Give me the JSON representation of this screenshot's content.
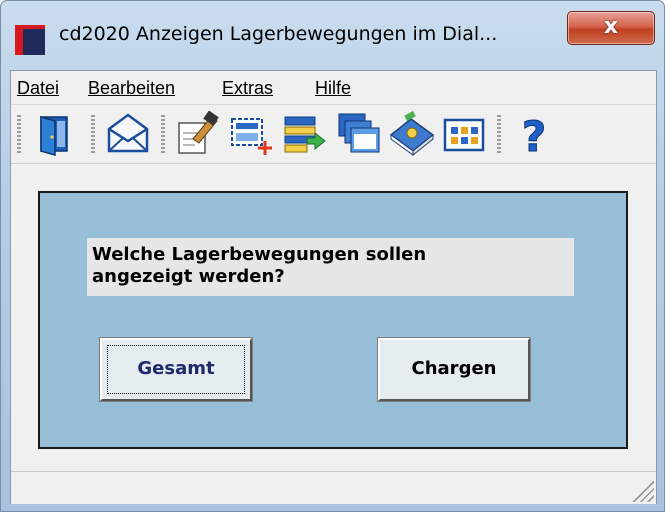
{
  "window": {
    "title": "cd2020 Anzeigen Lagerbewegungen im Dial...",
    "close_label": "x"
  },
  "menu": {
    "items": [
      {
        "label": "Datei",
        "accel": "D"
      },
      {
        "label": "Bearbeiten",
        "accel": "B"
      },
      {
        "label": "Extras",
        "accel": "x"
      },
      {
        "label": "Hilfe",
        "accel": "H"
      }
    ]
  },
  "toolbar": {
    "icons": [
      "exit-door-icon",
      "mail-icon",
      "edit-document-icon",
      "new-selection-icon",
      "import-list-icon",
      "windows-icon",
      "book-icon",
      "calendar-icon",
      "help-icon"
    ]
  },
  "dialog": {
    "question_line1": "Welche Lagerbewegungen sollen",
    "question_line2": "angezeigt werden?",
    "gesamt_label": "Gesamt",
    "chargen_label": "Chargen"
  },
  "colors": {
    "panel": "#98bfd8",
    "close_button": "#c0401f"
  }
}
